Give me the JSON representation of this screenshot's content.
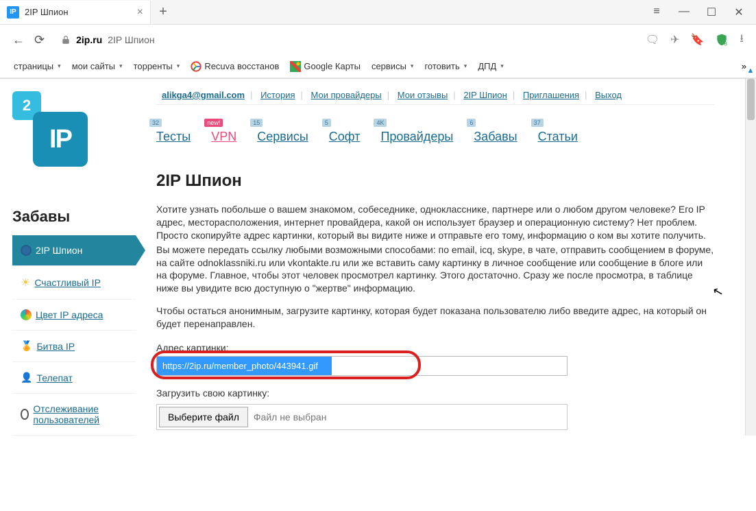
{
  "browser": {
    "tab_favicon_text": "IP",
    "tab_title": "2IP Шпион",
    "url_domain": "2ip.ru",
    "url_rest": "2IP Шпион",
    "bookmarks": [
      {
        "label": "страницы",
        "dropdown": true
      },
      {
        "label": "мои сайты",
        "dropdown": true
      },
      {
        "label": "торренты",
        "dropdown": true
      },
      {
        "label": "Recuva восстанов",
        "dropdown": false,
        "icon": "g"
      },
      {
        "label": "Google Карты",
        "dropdown": false,
        "icon": "map"
      },
      {
        "label": "сервисы",
        "dropdown": true
      },
      {
        "label": "готовить",
        "dropdown": true
      },
      {
        "label": "ДПД",
        "dropdown": true
      }
    ]
  },
  "user_nav": {
    "email": "alikga4@gmail.com",
    "links": [
      "История",
      "Мои провайдеры",
      "Мои отзывы",
      "2IP Шпион",
      "Приглашения",
      "Выход"
    ]
  },
  "main_nav": [
    {
      "label": "Тесты",
      "badge": "32"
    },
    {
      "label": "VPN",
      "badge": "new!",
      "new": true
    },
    {
      "label": "Сервисы",
      "badge": "15"
    },
    {
      "label": "Софт",
      "badge": "5"
    },
    {
      "label": "Провайдеры",
      "badge": "4K"
    },
    {
      "label": "Забавы",
      "badge": "6"
    },
    {
      "label": "Статьи",
      "badge": "37"
    }
  ],
  "sidebar": {
    "title": "Забавы",
    "items": [
      {
        "label": "2IP Шпион",
        "active": true
      },
      {
        "label": "Счастливый IP"
      },
      {
        "label": "Цвет IP адреса"
      },
      {
        "label": "Битва IP"
      },
      {
        "label": "Телепат"
      },
      {
        "label": "Отслеживание пользователей"
      }
    ]
  },
  "content": {
    "title": "2IP Шпион",
    "p1": "Хотите узнать побольше о вашем знакомом, собеседнике, однокласснике, партнере или о любом другом человеке? Его IP адрес, месторасположения, интернет провайдера, какой он использует браузер и операционную систему? Нет проблем. Просто скопируйте адрес картинки, который вы видите ниже и отправьте его тому, информацию о ком вы хотите получить.",
    "p2": "Вы можете передать ссылку любыми возможными способами: по email, icq, skype, в чате, отправить сообщением в форуме, на сайте odnoklassniki.ru или vkontakte.ru или же вставить саму картинку в личное сообщение или сообщение в блоге или на форуме. Главное, чтобы этот человек просмотрел картинку. Этого достаточно. Сразу же после просмотра, в таблице ниже  вы увидите всю доступную о \"жертве\" информацию.",
    "p3": "Чтобы остаться анонимным, загрузите картинку, которая будет показана пользователю либо введите адрес, на который он будет перенаправлен.",
    "label_url": "Адрес картинки:",
    "input_url": "https://2ip.ru/member_photo/443941.gif",
    "label_file": "Загрузить свою картинку:",
    "file_btn": "Выберите файл",
    "file_status": "Файл не выбран"
  },
  "logo": {
    "small": "2",
    "big": "IP"
  }
}
